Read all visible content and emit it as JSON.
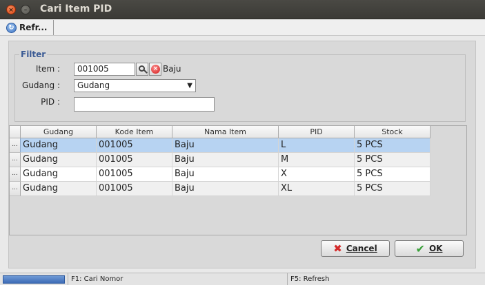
{
  "window": {
    "title": "Cari Item PID",
    "close_glyph": "×",
    "minimize_glyph": "–"
  },
  "toolbar": {
    "refresh_label": "Refr...",
    "refresh_icon": "refresh-icon"
  },
  "filter": {
    "legend": "Filter",
    "item_label": "Item :",
    "item_value": "001005",
    "item_name": "Baju",
    "gudang_label": "Gudang :",
    "gudang_value": "Gudang",
    "pid_label": "PID :",
    "pid_value": ""
  },
  "grid": {
    "columns": [
      "Gudang",
      "Kode Item",
      "Nama Item",
      "PID",
      "Stock"
    ],
    "rowhead_glyph": "...",
    "rows": [
      {
        "gudang": "Gudang",
        "kode_item": "001005",
        "nama_item": "Baju",
        "pid": "L",
        "stock": "5 PCS"
      },
      {
        "gudang": "Gudang",
        "kode_item": "001005",
        "nama_item": "Baju",
        "pid": "M",
        "stock": "5 PCS"
      },
      {
        "gudang": "Gudang",
        "kode_item": "001005",
        "nama_item": "Baju",
        "pid": "X",
        "stock": "5 PCS"
      },
      {
        "gudang": "Gudang",
        "kode_item": "001005",
        "nama_item": "Baju",
        "pid": "XL",
        "stock": "5 PCS"
      }
    ]
  },
  "buttons": {
    "cancel_label": "Cancel",
    "ok_label": "OK"
  },
  "status": {
    "f1": "F1: Cari Nomor",
    "f5": "F5: Refresh"
  },
  "colors": {
    "selection": "#b7d3f2",
    "legend": "#3a5a94",
    "progress": "#4a78c0"
  }
}
